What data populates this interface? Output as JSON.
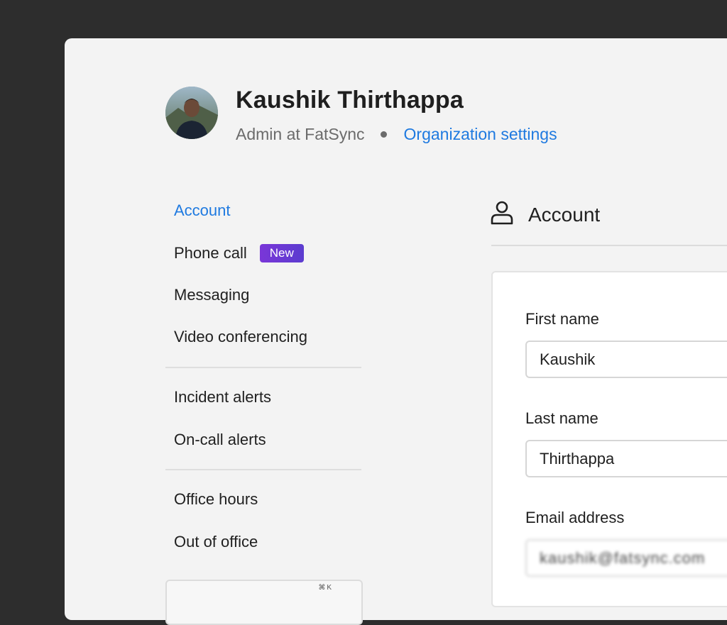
{
  "profile": {
    "name": "Kaushik Thirthappa",
    "role": "Admin at FatSync",
    "org_settings_link": "Organization settings"
  },
  "nav": {
    "group1": [
      {
        "label": "Account",
        "active": true
      },
      {
        "label": "Phone call",
        "badge": "New"
      },
      {
        "label": "Messaging"
      },
      {
        "label": "Video conferencing"
      }
    ],
    "group2": [
      {
        "label": "Incident alerts"
      },
      {
        "label": "On-call alerts"
      }
    ],
    "group3": [
      {
        "label": "Office hours"
      },
      {
        "label": "Out of office"
      }
    ],
    "shortcut_hint": "⌘K"
  },
  "section": {
    "title": "Account",
    "icon": "user-icon"
  },
  "form": {
    "first_name": {
      "label": "First name",
      "value": "Kaushik"
    },
    "last_name": {
      "label": "Last name",
      "value": "Thirthappa"
    },
    "email": {
      "label": "Email address",
      "value": "kaushik@fatsync.com"
    }
  },
  "colors": {
    "accent": "#1f7ae0",
    "badge_gradient_start": "#7a36d8",
    "badge_gradient_end": "#5b3ccf",
    "window_bg": "#f3f3f3",
    "desktop_bg": "#2d2d2d"
  }
}
